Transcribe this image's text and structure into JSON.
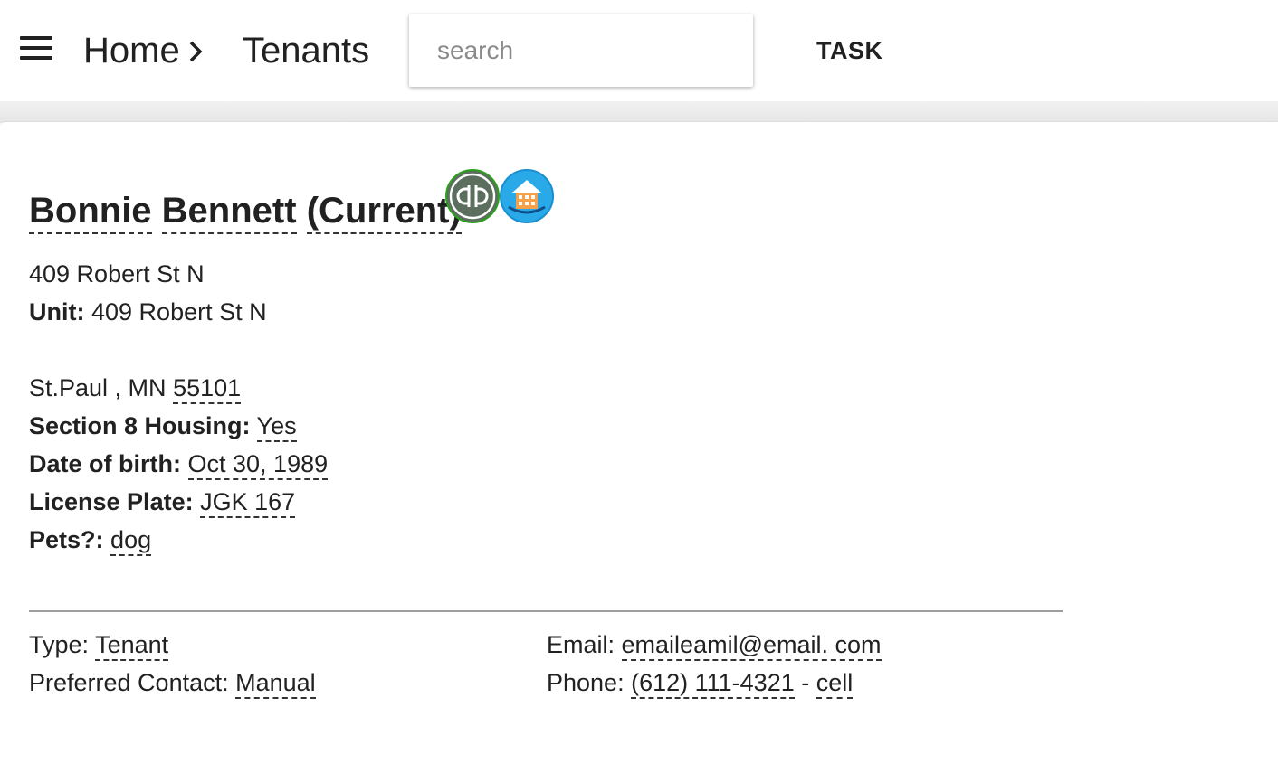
{
  "header": {
    "menu_icon": "hamburger-menu-icon",
    "breadcrumb_home": "Home",
    "breadcrumb_separator_icon": "chevron-right-icon",
    "breadcrumb_current": "Tenants",
    "search_placeholder": "search",
    "search_value": "",
    "task_label": "TASK"
  },
  "tenant": {
    "name_first": "Bonnie",
    "name_last": "Bennett",
    "status": "(Current)",
    "integration_icons": [
      "quickbooks-icon",
      "property-building-icon"
    ],
    "address_line1": "409 Robert St N",
    "unit_label": "Unit:",
    "unit_value": "409 Robert St N",
    "city_state": "St.Paul , MN",
    "zip": "55101",
    "section8_label": "Section 8 Housing:",
    "section8_value": "Yes",
    "dob_label": "Date of birth:",
    "dob_value": "Oct 30, 1989",
    "plate_label": "License Plate:",
    "plate_value": "JGK 167",
    "pets_label": "Pets?:",
    "pets_value": "dog"
  },
  "contact": {
    "type_label": "Type:",
    "type_value": "Tenant",
    "preferred_label": "Preferred Contact:",
    "preferred_value": "Manual",
    "email_label": "Email:",
    "email_value": "emaileamil@email. com",
    "phone_label": "Phone:",
    "phone_value": "(612) 111-4321",
    "phone_separator": "-",
    "phone_type": "cell"
  }
}
